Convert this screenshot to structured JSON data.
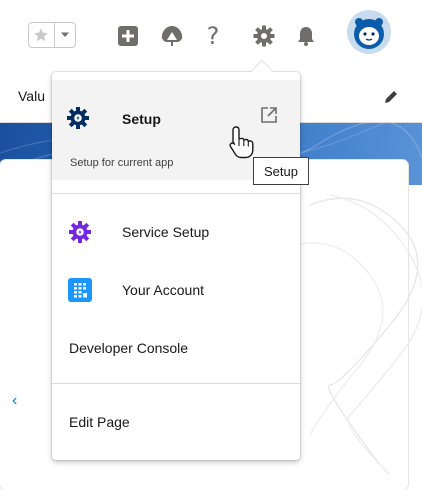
{
  "header": {
    "favorites_icon": "star-icon",
    "favorites_menu_icon": "chevron-down-icon",
    "global_actions_icon": "plus-icon",
    "trailhead_icon": "trailhead-icon",
    "help_icon": "question-icon",
    "help_label": "?",
    "setup_icon": "gear-icon",
    "notifications_icon": "bell-icon",
    "avatar_icon": "astro-avatar"
  },
  "page": {
    "subbar_label": "Valu",
    "edit_icon": "pencil-icon",
    "prev_chevron": "‹"
  },
  "menu": {
    "setup": {
      "title": "Setup",
      "subtitle": "Setup for current app",
      "icon": "gear-icon",
      "open_new_window_icon": "external-link-icon"
    },
    "items": [
      {
        "label": "Service Setup",
        "icon": "gear-icon",
        "icon_color": "#7526e3"
      },
      {
        "label": "Your Account",
        "icon": "building-icon",
        "icon_color": "#1b96ff"
      },
      {
        "label": "Developer Console"
      }
    ],
    "edit_page": "Edit Page"
  },
  "tooltip": {
    "text": "Setup"
  },
  "colors": {
    "setup_gear": "#032d60",
    "service_gear": "#7526e3",
    "account_tile": "#1b96ff",
    "header_icon": "#706e6b",
    "banner": "#1a4f9e"
  }
}
